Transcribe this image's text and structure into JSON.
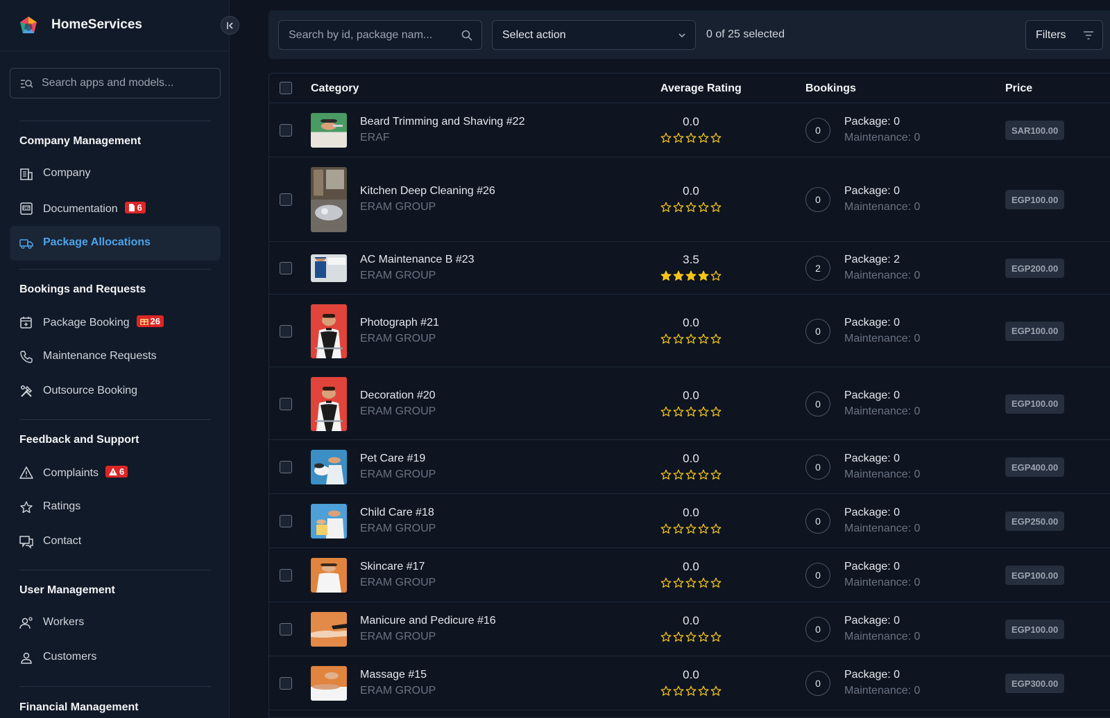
{
  "app": {
    "name": "HomeServices"
  },
  "sidebar": {
    "search_placeholder": "Search apps and models...",
    "sections": [
      {
        "title": "Company Management",
        "items": [
          {
            "label": "Company",
            "icon": "building-icon"
          },
          {
            "label": "Documentation",
            "icon": "pdf-document-icon",
            "badge": "6",
            "badge_icon": "document-icon"
          },
          {
            "label": "Package Allocations",
            "icon": "truck-icon",
            "active": true
          }
        ]
      },
      {
        "title": "Bookings and Requests",
        "items": [
          {
            "label": "Package Booking",
            "icon": "calendar-plus-icon",
            "badge": "26",
            "badge_icon": "gift-icon"
          },
          {
            "label": "Maintenance Requests",
            "icon": "phone-icon"
          },
          {
            "label": "Outsource Booking",
            "icon": "tools-icon"
          }
        ]
      },
      {
        "title": "Feedback and Support",
        "items": [
          {
            "label": "Complaints",
            "icon": "warning-triangle-icon",
            "badge": "6",
            "badge_icon": "alert-icon"
          },
          {
            "label": "Ratings",
            "icon": "star-icon"
          },
          {
            "label": "Contact",
            "icon": "chat-icon"
          }
        ]
      },
      {
        "title": "User Management",
        "items": [
          {
            "label": "Workers",
            "icon": "workers-icon"
          },
          {
            "label": "Customers",
            "icon": "user-icon"
          }
        ]
      },
      {
        "title": "Financial Management",
        "items": []
      }
    ]
  },
  "toolbar": {
    "search_placeholder": "Search by id, package nam...",
    "action_select": "Select action",
    "selection_count": "0 of 25 selected",
    "filters_label": "Filters"
  },
  "table": {
    "columns": [
      "Category",
      "Average Rating",
      "Bookings",
      "Price"
    ],
    "rows": [
      {
        "name": "Beard Trimming and Shaving #22",
        "company": "ERAF",
        "rating": "0.0",
        "stars": 0,
        "bookings": "0",
        "package": "Package: 0",
        "maintenance": "Maintenance: 0",
        "price": "SAR100.00",
        "thumb": "barber"
      },
      {
        "name": "Kitchen Deep Cleaning #26",
        "company": "ERAM GROUP",
        "rating": "0.0",
        "stars": 0,
        "bookings": "0",
        "package": "Package: 0",
        "maintenance": "Maintenance: 0",
        "price": "EGP100.00",
        "thumb": "kitchen"
      },
      {
        "name": "AC Maintenance B #23",
        "company": "ERAM GROUP",
        "rating": "3.5",
        "stars": 4,
        "bookings": "2",
        "package": "Package: 2",
        "maintenance": "Maintenance: 0",
        "price": "EGP200.00",
        "thumb": "ac"
      },
      {
        "name": "Photograph #21",
        "company": "ERAM GROUP",
        "rating": "0.0",
        "stars": 0,
        "bookings": "0",
        "package": "Package: 0",
        "maintenance": "Maintenance: 0",
        "price": "EGP100.00",
        "thumb": "waiter"
      },
      {
        "name": "Decoration #20",
        "company": "ERAM GROUP",
        "rating": "0.0",
        "stars": 0,
        "bookings": "0",
        "package": "Package: 0",
        "maintenance": "Maintenance: 0",
        "price": "EGP100.00",
        "thumb": "waiter"
      },
      {
        "name": "Pet Care #19",
        "company": "ERAM GROUP",
        "rating": "0.0",
        "stars": 0,
        "bookings": "0",
        "package": "Package: 0",
        "maintenance": "Maintenance: 0",
        "price": "EGP400.00",
        "thumb": "pet"
      },
      {
        "name": "Child Care #18",
        "company": "ERAM GROUP",
        "rating": "0.0",
        "stars": 0,
        "bookings": "0",
        "package": "Package: 0",
        "maintenance": "Maintenance: 0",
        "price": "EGP250.00",
        "thumb": "child"
      },
      {
        "name": "Skincare #17",
        "company": "ERAM GROUP",
        "rating": "0.0",
        "stars": 0,
        "bookings": "0",
        "package": "Package: 0",
        "maintenance": "Maintenance: 0",
        "price": "EGP100.00",
        "thumb": "skin"
      },
      {
        "name": "Manicure and Pedicure #16",
        "company": "ERAM GROUP",
        "rating": "0.0",
        "stars": 0,
        "bookings": "0",
        "package": "Package: 0",
        "maintenance": "Maintenance: 0",
        "price": "EGP100.00",
        "thumb": "mani"
      },
      {
        "name": "Massage #15",
        "company": "ERAM GROUP",
        "rating": "0.0",
        "stars": 0,
        "bookings": "0",
        "package": "Package: 0",
        "maintenance": "Maintenance: 0",
        "price": "EGP300.00",
        "thumb": "massage"
      }
    ]
  },
  "colors": {
    "accent": "#4ea3e8",
    "badge": "#dc2626",
    "star": "#f5c518",
    "background": "#0e1521"
  }
}
